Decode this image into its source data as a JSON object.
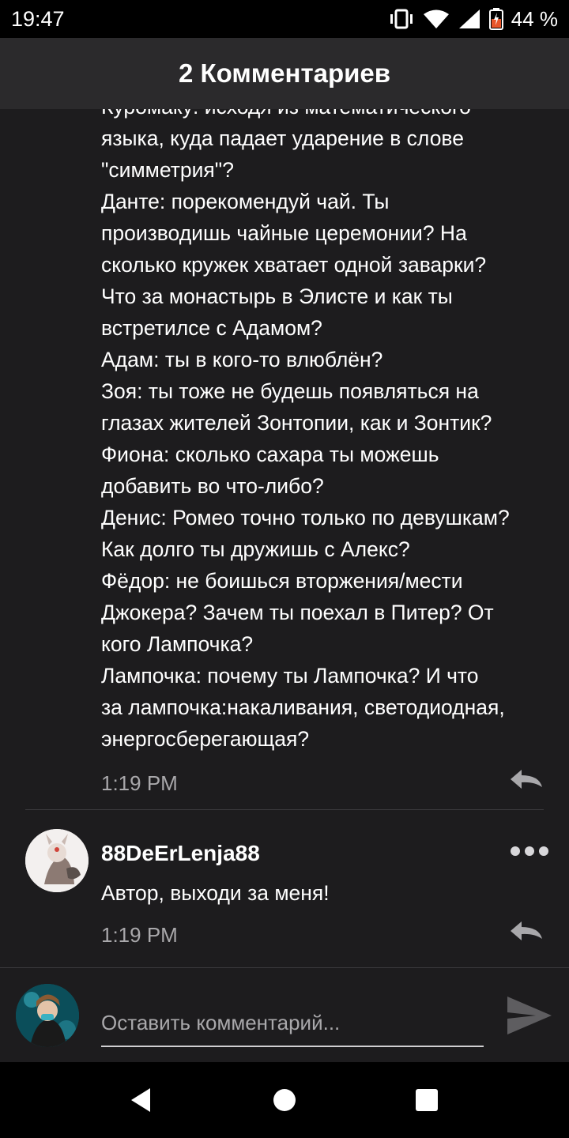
{
  "status_bar": {
    "time": "19:47",
    "battery": "44 %",
    "icons": [
      "vibrate-icon",
      "wifi-icon",
      "signal-icon",
      "battery-icon"
    ]
  },
  "header": {
    "title": "2 Комментариев"
  },
  "comments": [
    {
      "text_lines": [
        "Куромаку: исходя из математического",
        "языка, куда падает ударение в слове",
        "\"симметрия\"?",
        "Данте: порекомендуй чай. Ты",
        "производишь чайные церемонии? На",
        "сколько кружек хватает одной заварки?",
        "Что за монастырь в Элисте и как ты",
        "встретилсе с Адамом?",
        "Адам: ты в кого-то влюблён?",
        "Зоя: ты тоже не будешь появляться на",
        "глазах жителей Зонтопии, как и Зонтик?",
        "Фиона: сколько сахара ты можешь",
        "добавить во что-либо?",
        "Денис: Ромео точно только по девушкам?",
        "Как долго ты дружишь с Алекс?",
        "Фёдор: не боишься вторжения/мести",
        "Джокера? Зачем ты поехал в Питер? От",
        "кого Лампочка?",
        "Лампочка: почему ты Лампочка? И что",
        "за лампочка:накаливания, светодиодная,",
        "энергосберегающая?"
      ],
      "time": "1:19 PM"
    },
    {
      "author": "88DeErLenja88",
      "text": "Автор, выходи за меня!",
      "time": "1:19 PM"
    }
  ],
  "composer": {
    "placeholder": "Оставить комментарий..."
  },
  "colors": {
    "background": "#1d1c1e",
    "header_bg": "#2b2a2c",
    "muted_text": "#a9a8ab"
  }
}
